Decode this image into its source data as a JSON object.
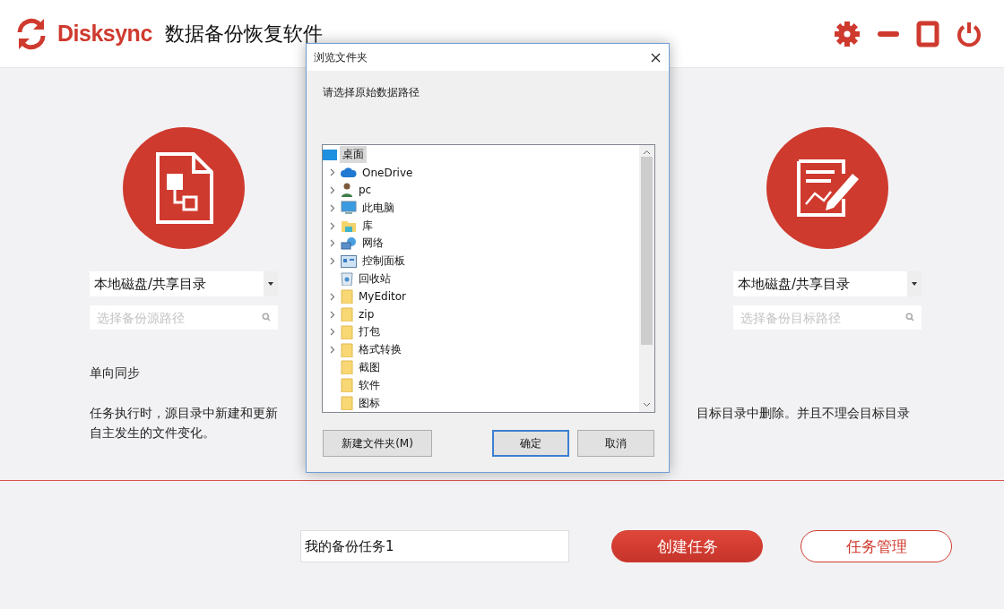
{
  "header": {
    "brand": "Disksync",
    "title": "数据备份恢复软件"
  },
  "source": {
    "select_value": "本地磁盘/共享目录",
    "path_placeholder": "选择备份源路径"
  },
  "target": {
    "select_value": "本地磁盘/共享目录",
    "path_placeholder": "选择备份目标路径"
  },
  "mode": {
    "title": "单向同步",
    "line_1_left": "任务执行时，源目录中新建和更新",
    "line_1_right": "目标目录中删除。并且不理会目标目录",
    "line_2": "自主发生的文件变化。"
  },
  "footer": {
    "task_name": "我的备份任务1",
    "buttons": [
      {
        "label": "创建任务",
        "kind": "primary"
      },
      {
        "label": "任务管理",
        "kind": "outline"
      }
    ]
  },
  "dialog": {
    "title": "浏览文件夹",
    "prompt": "请选择原始数据路径",
    "tree": [
      {
        "label": "桌面",
        "kind": "desktop",
        "selected": true,
        "children": [
          {
            "label": "OneDrive",
            "kind": "cloud",
            "selected": false,
            "expandable": true
          },
          {
            "label": "pc",
            "kind": "user",
            "selected": false,
            "expandable": true
          },
          {
            "label": "此电脑",
            "kind": "computer",
            "selected": false,
            "expandable": true
          },
          {
            "label": "库",
            "kind": "library",
            "selected": false,
            "expandable": true
          },
          {
            "label": "网络",
            "kind": "network",
            "selected": false,
            "expandable": true
          },
          {
            "label": "控制面板",
            "kind": "panel",
            "selected": false,
            "expandable": true
          },
          {
            "label": "回收站",
            "kind": "recycle",
            "selected": false,
            "expandable": false
          },
          {
            "label": "MyEditor",
            "kind": "folder",
            "selected": false,
            "expandable": true
          },
          {
            "label": "zip",
            "kind": "folder",
            "selected": false,
            "expandable": true
          },
          {
            "label": "打包",
            "kind": "folder",
            "selected": false,
            "expandable": true
          },
          {
            "label": "格式转换",
            "kind": "folder",
            "selected": false,
            "expandable": true
          },
          {
            "label": "截图",
            "kind": "folder",
            "selected": false,
            "expandable": false
          },
          {
            "label": "软件",
            "kind": "folder",
            "selected": false,
            "expandable": false
          },
          {
            "label": "图标",
            "kind": "folder",
            "selected": false,
            "expandable": false
          }
        ]
      }
    ],
    "buttons": [
      {
        "label": "新建文件夹(M)",
        "kind": "normal"
      },
      {
        "label": "确定",
        "kind": "default"
      },
      {
        "label": "取消",
        "kind": "normal"
      }
    ]
  }
}
